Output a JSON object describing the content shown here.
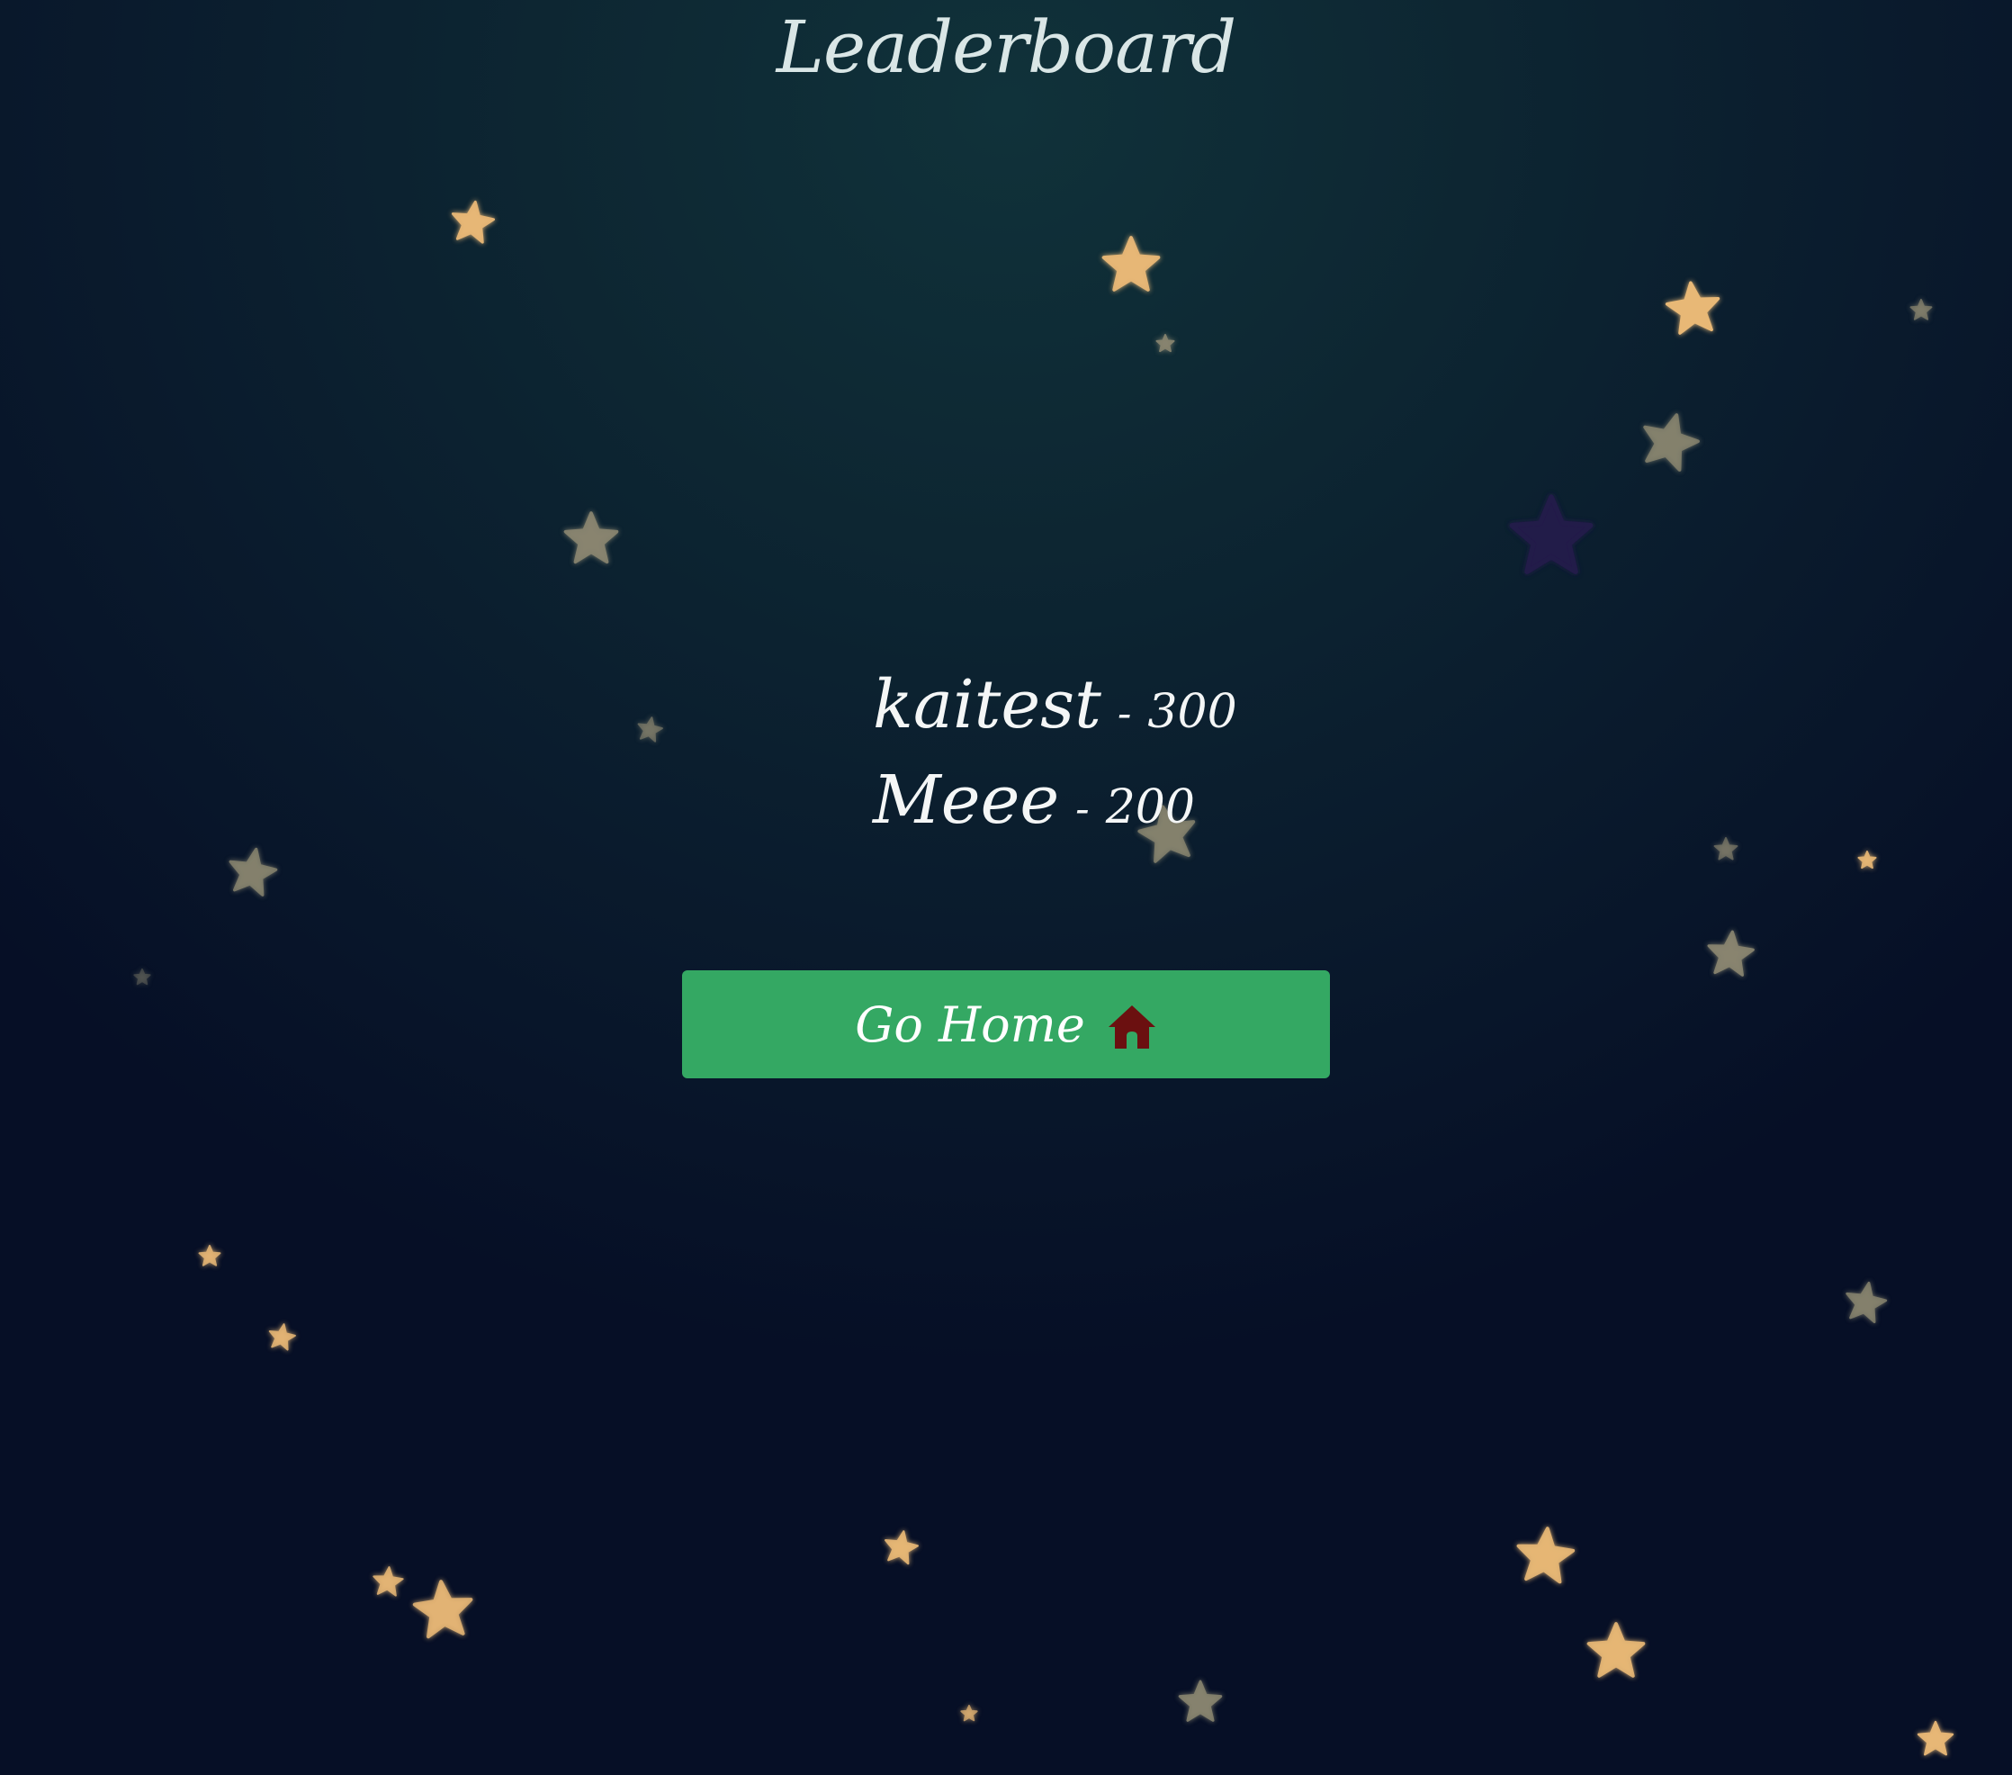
{
  "page": {
    "title": "Leaderboard"
  },
  "leaderboard": {
    "separator": "-",
    "entries": [
      {
        "name": "kaitest",
        "score": "300"
      },
      {
        "name": "Meee",
        "score": "200"
      }
    ]
  },
  "home_button": {
    "label": "Go Home",
    "icon": "home-icon",
    "color": "#34a863",
    "icon_color": "#6b1010"
  },
  "colors": {
    "background": "#0b1d2e",
    "star_gold": "#e8b876",
    "star_grey": "#8a8670",
    "star_indigo": "#221a4a"
  }
}
